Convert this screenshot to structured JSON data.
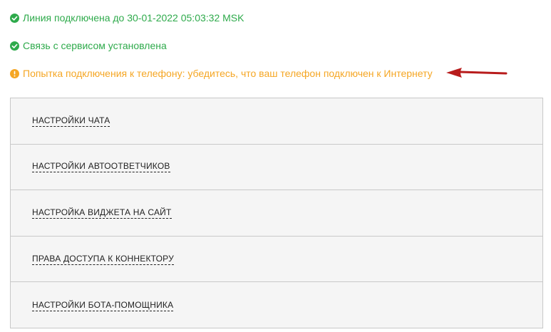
{
  "status": {
    "line_connected": "Линия подключена до 30-01-2022 05:03:32 MSK",
    "service_connected": "Связь с сервисом установлена",
    "phone_warning": "Попытка подключения к телефону: убедитесь, что ваш телефон подключен к Интернету"
  },
  "colors": {
    "ok": "#2eaa4b",
    "warn": "#f5a623",
    "arrow": "#b81c1c"
  },
  "accordion": {
    "items": [
      {
        "label": "НАСТРОЙКИ ЧАТА"
      },
      {
        "label": "НАСТРОЙКИ АВТООТВЕТЧИКОВ"
      },
      {
        "label": "НАСТРОЙКА ВИДЖЕТА НА САЙТ"
      },
      {
        "label": "ПРАВА ДОСТУПА К КОННЕКТОРУ"
      },
      {
        "label": "НАСТРОЙКИ БОТА-ПОМОЩНИКА"
      }
    ]
  }
}
